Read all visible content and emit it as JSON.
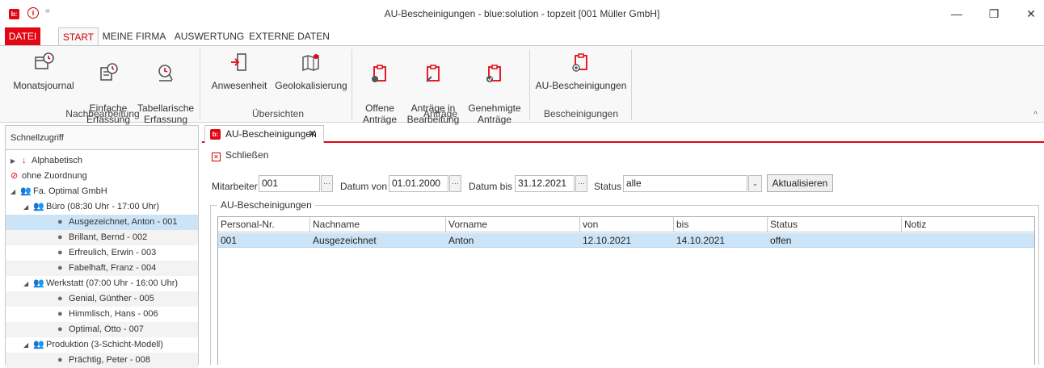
{
  "window": {
    "title": "AU-Bescheinigungen - blue:solution - topzeit [001 Müller GmbH]",
    "logo_text": "b:",
    "qa_info": "i",
    "qa_more": "=",
    "minimize": "—",
    "restore": "❐",
    "close": "✕"
  },
  "menu_tabs": [
    "DATEI",
    "START",
    "MEINE FIRMA",
    "AUSWERTUNG",
    "EXTERNE DATEN"
  ],
  "ribbon": {
    "groups": [
      {
        "label": "Nachbearbeitung",
        "buttons": [
          "Monatsjournal",
          "Einfache\nErfassung",
          "Tabellarische\nErfassung"
        ]
      },
      {
        "label": "Übersichten",
        "buttons": [
          "Anwesenheit",
          "Geolokalisierung"
        ]
      },
      {
        "label": "Anträge",
        "buttons": [
          "Offene\nAnträge",
          "Anträge in\nBearbeitung",
          "Genehmigte\nAnträge"
        ]
      },
      {
        "label": "Bescheinigungen",
        "buttons": [
          "AU-Bescheinigungen"
        ]
      }
    ],
    "collapse_icon": "^"
  },
  "quick_access": {
    "header": "Schnellzugriff",
    "items": [
      {
        "label": "Alphabetisch",
        "icon": "sort-az-icon"
      },
      {
        "label": "ohne Zuordnung",
        "icon": "no-assignment-icon"
      },
      {
        "label": "Fa. Optimal GmbH",
        "icon": "group-icon"
      },
      {
        "label": "Büro (08:30 Uhr - 17:00 Uhr)",
        "icon": "group-icon"
      },
      {
        "label": "Ausgezeichnet, Anton - 001",
        "icon": "person-icon"
      },
      {
        "label": "Brillant, Bernd - 002",
        "icon": "person-icon"
      },
      {
        "label": "Erfreulich, Erwin - 003",
        "icon": "person-icon"
      },
      {
        "label": "Fabelhaft, Franz - 004",
        "icon": "person-icon"
      },
      {
        "label": "Werkstatt (07:00 Uhr - 16:00 Uhr)",
        "icon": "group-icon"
      },
      {
        "label": "Genial, Günther - 005",
        "icon": "person-icon"
      },
      {
        "label": "Himmlisch, Hans - 006",
        "icon": "person-icon"
      },
      {
        "label": "Optimal, Otto - 007",
        "icon": "person-icon"
      },
      {
        "label": "Produktion (3-Schicht-Modell)",
        "icon": "group-icon"
      },
      {
        "label": "Prächtig, Peter - 008",
        "icon": "person-icon"
      }
    ]
  },
  "doc_tab": {
    "label": "AU-Bescheinigungen",
    "close": "✕"
  },
  "toolbar": {
    "close_label": "Schließen",
    "close_icon_glyph": "✕"
  },
  "filters": {
    "mitarbeiter_label": "Mitarbeiter",
    "mitarbeiter_value": "001",
    "datum_von_label": "Datum von",
    "datum_von_value": "01.01.2000",
    "datum_bis_label": "Datum bis",
    "datum_bis_value": "31.12.2021",
    "status_label": "Status",
    "status_value": "alle",
    "dots": "···",
    "dropdown_arrow": "⌄",
    "refresh_label": "Aktualisieren"
  },
  "grid": {
    "section_title": "AU-Bescheinigungen",
    "columns": [
      "Personal-Nr.",
      "Nachname",
      "Vorname",
      "von",
      "bis",
      "Status",
      "Notiz"
    ],
    "rows": [
      [
        "001",
        "Ausgezeichnet",
        "Anton",
        "12.10.2021",
        "14.10.2021",
        "offen",
        ""
      ]
    ]
  },
  "colors": {
    "accent": "#e30613",
    "selection": "#cce4f7"
  }
}
